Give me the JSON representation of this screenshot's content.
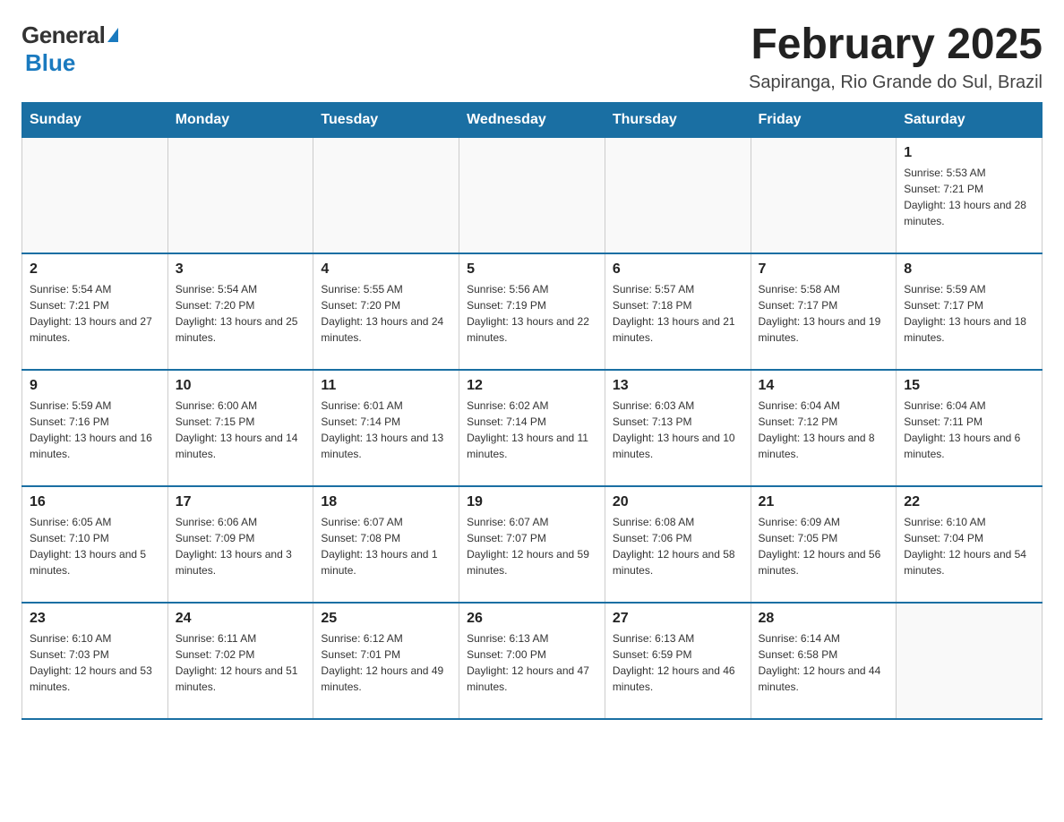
{
  "header": {
    "logo_general": "General",
    "logo_blue": "Blue",
    "month_title": "February 2025",
    "location": "Sapiranga, Rio Grande do Sul, Brazil"
  },
  "days_of_week": [
    "Sunday",
    "Monday",
    "Tuesday",
    "Wednesday",
    "Thursday",
    "Friday",
    "Saturday"
  ],
  "weeks": [
    [
      {
        "day": "",
        "sunrise": "",
        "sunset": "",
        "daylight": ""
      },
      {
        "day": "",
        "sunrise": "",
        "sunset": "",
        "daylight": ""
      },
      {
        "day": "",
        "sunrise": "",
        "sunset": "",
        "daylight": ""
      },
      {
        "day": "",
        "sunrise": "",
        "sunset": "",
        "daylight": ""
      },
      {
        "day": "",
        "sunrise": "",
        "sunset": "",
        "daylight": ""
      },
      {
        "day": "",
        "sunrise": "",
        "sunset": "",
        "daylight": ""
      },
      {
        "day": "1",
        "sunrise": "Sunrise: 5:53 AM",
        "sunset": "Sunset: 7:21 PM",
        "daylight": "Daylight: 13 hours and 28 minutes."
      }
    ],
    [
      {
        "day": "2",
        "sunrise": "Sunrise: 5:54 AM",
        "sunset": "Sunset: 7:21 PM",
        "daylight": "Daylight: 13 hours and 27 minutes."
      },
      {
        "day": "3",
        "sunrise": "Sunrise: 5:54 AM",
        "sunset": "Sunset: 7:20 PM",
        "daylight": "Daylight: 13 hours and 25 minutes."
      },
      {
        "day": "4",
        "sunrise": "Sunrise: 5:55 AM",
        "sunset": "Sunset: 7:20 PM",
        "daylight": "Daylight: 13 hours and 24 minutes."
      },
      {
        "day": "5",
        "sunrise": "Sunrise: 5:56 AM",
        "sunset": "Sunset: 7:19 PM",
        "daylight": "Daylight: 13 hours and 22 minutes."
      },
      {
        "day": "6",
        "sunrise": "Sunrise: 5:57 AM",
        "sunset": "Sunset: 7:18 PM",
        "daylight": "Daylight: 13 hours and 21 minutes."
      },
      {
        "day": "7",
        "sunrise": "Sunrise: 5:58 AM",
        "sunset": "Sunset: 7:17 PM",
        "daylight": "Daylight: 13 hours and 19 minutes."
      },
      {
        "day": "8",
        "sunrise": "Sunrise: 5:59 AM",
        "sunset": "Sunset: 7:17 PM",
        "daylight": "Daylight: 13 hours and 18 minutes."
      }
    ],
    [
      {
        "day": "9",
        "sunrise": "Sunrise: 5:59 AM",
        "sunset": "Sunset: 7:16 PM",
        "daylight": "Daylight: 13 hours and 16 minutes."
      },
      {
        "day": "10",
        "sunrise": "Sunrise: 6:00 AM",
        "sunset": "Sunset: 7:15 PM",
        "daylight": "Daylight: 13 hours and 14 minutes."
      },
      {
        "day": "11",
        "sunrise": "Sunrise: 6:01 AM",
        "sunset": "Sunset: 7:14 PM",
        "daylight": "Daylight: 13 hours and 13 minutes."
      },
      {
        "day": "12",
        "sunrise": "Sunrise: 6:02 AM",
        "sunset": "Sunset: 7:14 PM",
        "daylight": "Daylight: 13 hours and 11 minutes."
      },
      {
        "day": "13",
        "sunrise": "Sunrise: 6:03 AM",
        "sunset": "Sunset: 7:13 PM",
        "daylight": "Daylight: 13 hours and 10 minutes."
      },
      {
        "day": "14",
        "sunrise": "Sunrise: 6:04 AM",
        "sunset": "Sunset: 7:12 PM",
        "daylight": "Daylight: 13 hours and 8 minutes."
      },
      {
        "day": "15",
        "sunrise": "Sunrise: 6:04 AM",
        "sunset": "Sunset: 7:11 PM",
        "daylight": "Daylight: 13 hours and 6 minutes."
      }
    ],
    [
      {
        "day": "16",
        "sunrise": "Sunrise: 6:05 AM",
        "sunset": "Sunset: 7:10 PM",
        "daylight": "Daylight: 13 hours and 5 minutes."
      },
      {
        "day": "17",
        "sunrise": "Sunrise: 6:06 AM",
        "sunset": "Sunset: 7:09 PM",
        "daylight": "Daylight: 13 hours and 3 minutes."
      },
      {
        "day": "18",
        "sunrise": "Sunrise: 6:07 AM",
        "sunset": "Sunset: 7:08 PM",
        "daylight": "Daylight: 13 hours and 1 minute."
      },
      {
        "day": "19",
        "sunrise": "Sunrise: 6:07 AM",
        "sunset": "Sunset: 7:07 PM",
        "daylight": "Daylight: 12 hours and 59 minutes."
      },
      {
        "day": "20",
        "sunrise": "Sunrise: 6:08 AM",
        "sunset": "Sunset: 7:06 PM",
        "daylight": "Daylight: 12 hours and 58 minutes."
      },
      {
        "day": "21",
        "sunrise": "Sunrise: 6:09 AM",
        "sunset": "Sunset: 7:05 PM",
        "daylight": "Daylight: 12 hours and 56 minutes."
      },
      {
        "day": "22",
        "sunrise": "Sunrise: 6:10 AM",
        "sunset": "Sunset: 7:04 PM",
        "daylight": "Daylight: 12 hours and 54 minutes."
      }
    ],
    [
      {
        "day": "23",
        "sunrise": "Sunrise: 6:10 AM",
        "sunset": "Sunset: 7:03 PM",
        "daylight": "Daylight: 12 hours and 53 minutes."
      },
      {
        "day": "24",
        "sunrise": "Sunrise: 6:11 AM",
        "sunset": "Sunset: 7:02 PM",
        "daylight": "Daylight: 12 hours and 51 minutes."
      },
      {
        "day": "25",
        "sunrise": "Sunrise: 6:12 AM",
        "sunset": "Sunset: 7:01 PM",
        "daylight": "Daylight: 12 hours and 49 minutes."
      },
      {
        "day": "26",
        "sunrise": "Sunrise: 6:13 AM",
        "sunset": "Sunset: 7:00 PM",
        "daylight": "Daylight: 12 hours and 47 minutes."
      },
      {
        "day": "27",
        "sunrise": "Sunrise: 6:13 AM",
        "sunset": "Sunset: 6:59 PM",
        "daylight": "Daylight: 12 hours and 46 minutes."
      },
      {
        "day": "28",
        "sunrise": "Sunrise: 6:14 AM",
        "sunset": "Sunset: 6:58 PM",
        "daylight": "Daylight: 12 hours and 44 minutes."
      },
      {
        "day": "",
        "sunrise": "",
        "sunset": "",
        "daylight": ""
      }
    ]
  ]
}
